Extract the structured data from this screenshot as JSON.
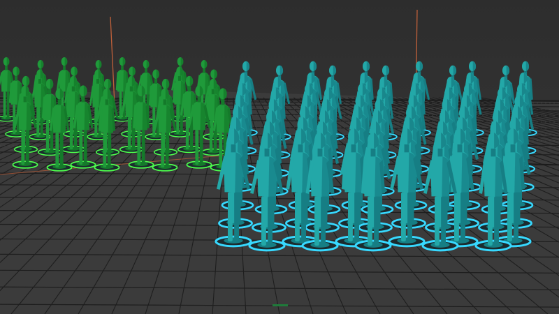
{
  "viewport": {
    "panel": "perspective-viewport",
    "background_top": "#2d2d2d",
    "background_bottom": "#3c3c3c",
    "grid_color": "#1e1e1e",
    "grid_highlight": "#5a5a5a",
    "axis_color": "#c0603a"
  },
  "crowds": [
    {
      "name": "green-crowd",
      "body_color": "#1f9a3a",
      "shade_color": "#147a2a",
      "ring_color": "#4dff4d",
      "selected": false
    },
    {
      "name": "teal-crowd",
      "body_color": "#23a8a8",
      "shade_color": "#167e84",
      "ring_color": "#37d9ff",
      "selected": true
    }
  ]
}
